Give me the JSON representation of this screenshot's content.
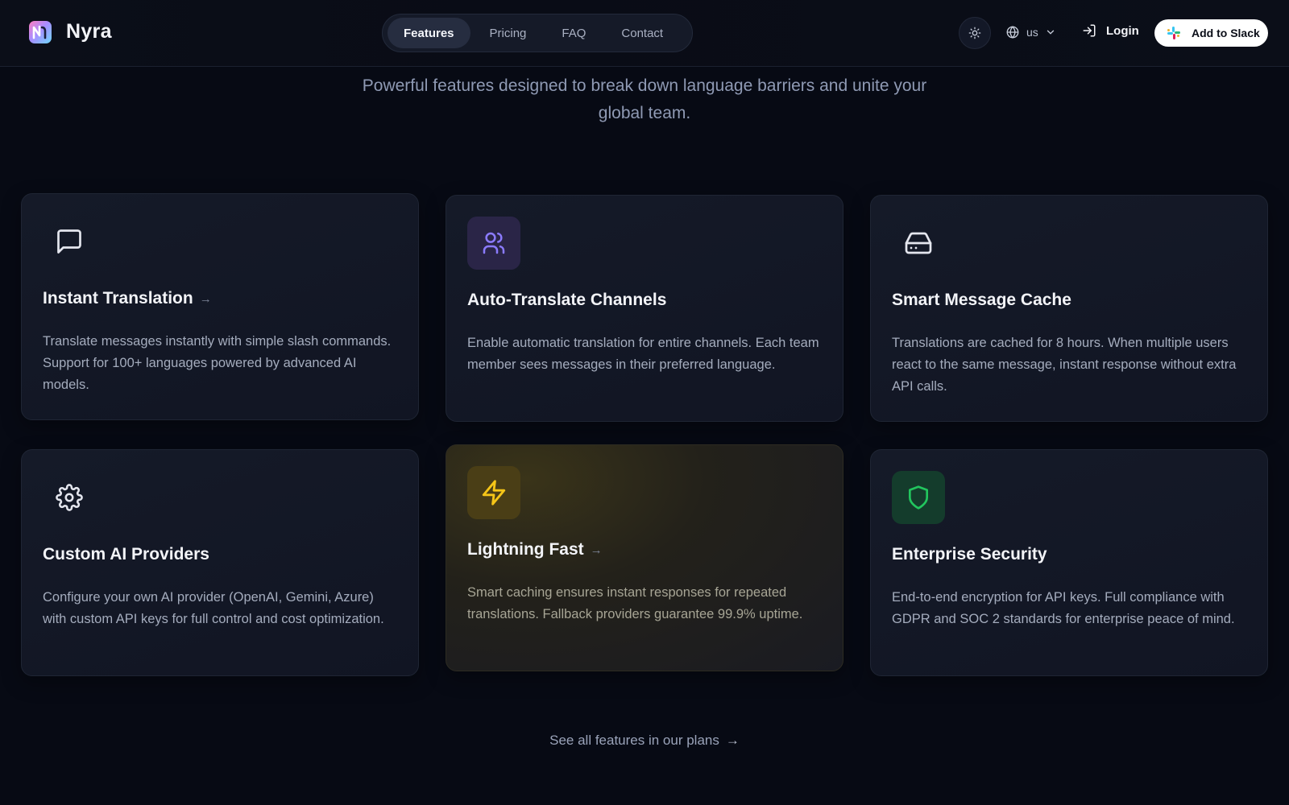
{
  "brand": {
    "name": "Nyra"
  },
  "nav": {
    "items": [
      {
        "label": "Features",
        "active": true
      },
      {
        "label": "Pricing",
        "active": false
      },
      {
        "label": "FAQ",
        "active": false
      },
      {
        "label": "Contact",
        "active": false
      }
    ]
  },
  "header": {
    "theme_icon": "sun-icon",
    "language": "us",
    "login_label": "Login",
    "slack_label": "Add to Slack"
  },
  "hero": {
    "subtitle": "Powerful features designed to break down language barriers and unite your global team."
  },
  "features": [
    {
      "title": "Instant Translation",
      "icon": "message-square-icon",
      "desc": "Translate messages instantly with simple slash commands. Support for 100+ languages powered by advanced AI models.",
      "arrow": "→"
    },
    {
      "title": "Auto-Translate Channels",
      "icon": "users-icon",
      "desc": "Enable automatic translation for entire channels. Each team member sees messages in their preferred language.",
      "arrow": ""
    },
    {
      "title": "Smart Message Cache",
      "icon": "hard-drive-icon",
      "desc": "Translations are cached for 8 hours. When multiple users react to the same message, instant response without extra API calls.",
      "arrow": ""
    },
    {
      "title": "Custom AI Providers",
      "icon": "gear-icon",
      "desc": "Configure your own AI provider (OpenAI, Gemini, Azure) with custom API keys for full control and cost optimization.",
      "arrow": ""
    },
    {
      "title": "Lightning Fast",
      "icon": "lightning-icon",
      "desc": "Smart caching ensures instant responses for repeated translations. Fallback providers guarantee 99.9% uptime.",
      "arrow": "→"
    },
    {
      "title": "Enterprise Security",
      "icon": "shield-icon",
      "desc": "End-to-end encryption for API keys. Full compliance with GDPR and SOC 2 standards for enterprise peace of mind.",
      "arrow": ""
    }
  ],
  "footer": {
    "link_label": "See all features in our plans",
    "arrow": "→"
  },
  "colors": {
    "background": "#070a14",
    "card": "#151a28",
    "purple_accent": "#8b7bff",
    "gold_accent": "#f5c518",
    "green_accent": "#22c55e"
  }
}
